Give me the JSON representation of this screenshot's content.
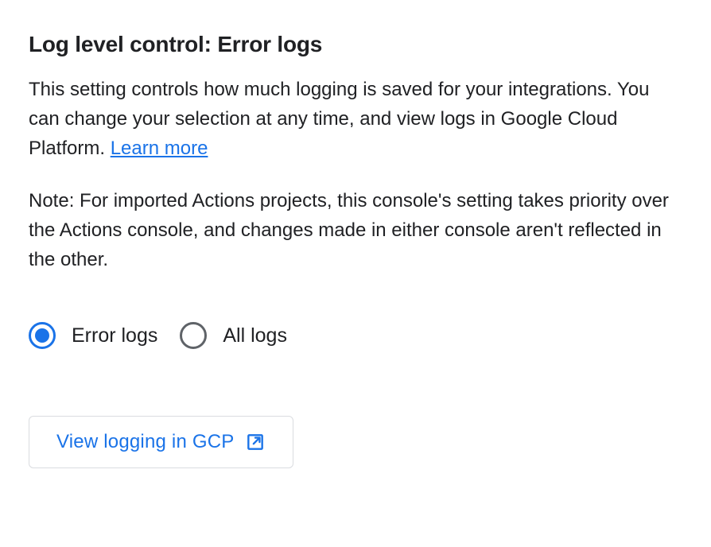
{
  "heading": "Log level control: Error logs",
  "description_part1": "This setting controls how much logging is saved for your integrations. You can change your selection at any time, and view logs in Google Cloud Platform. ",
  "learn_more": "Learn more",
  "note": "Note: For imported Actions projects, this console's setting takes priority over the Actions console, and changes made in either console aren't reflected in the other.",
  "radios": {
    "error_logs": "Error logs",
    "all_logs": "All logs",
    "selected": "error_logs"
  },
  "button": {
    "label": "View logging in GCP"
  },
  "colors": {
    "link": "#1a73e8",
    "text": "#202124",
    "border": "#dadce0",
    "radio_unselected": "#5f6368"
  }
}
